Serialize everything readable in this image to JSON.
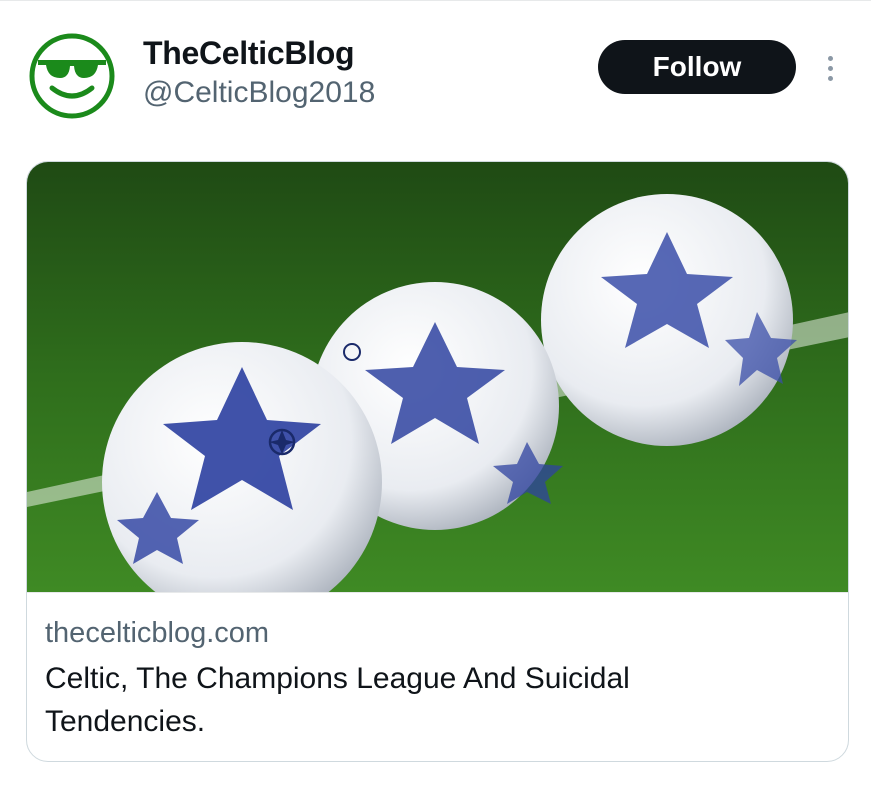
{
  "account": {
    "display_name": "TheCelticBlog",
    "handle": "@CelticBlog2018",
    "avatar_icon": "sunglasses-smiley-icon",
    "avatar_color": "#1b8a1b"
  },
  "actions": {
    "follow_label": "Follow",
    "more_icon": "more-vertical-icon"
  },
  "link_card": {
    "image_description_icon": "football-image",
    "domain": "thecelticblog.com",
    "title": "Celtic, The Champions League And Suicidal Tendencies."
  },
  "colors": {
    "primary_text": "#0f1419",
    "secondary_text": "#536471",
    "follow_bg": "#0f1419",
    "border": "#cfd9de"
  }
}
